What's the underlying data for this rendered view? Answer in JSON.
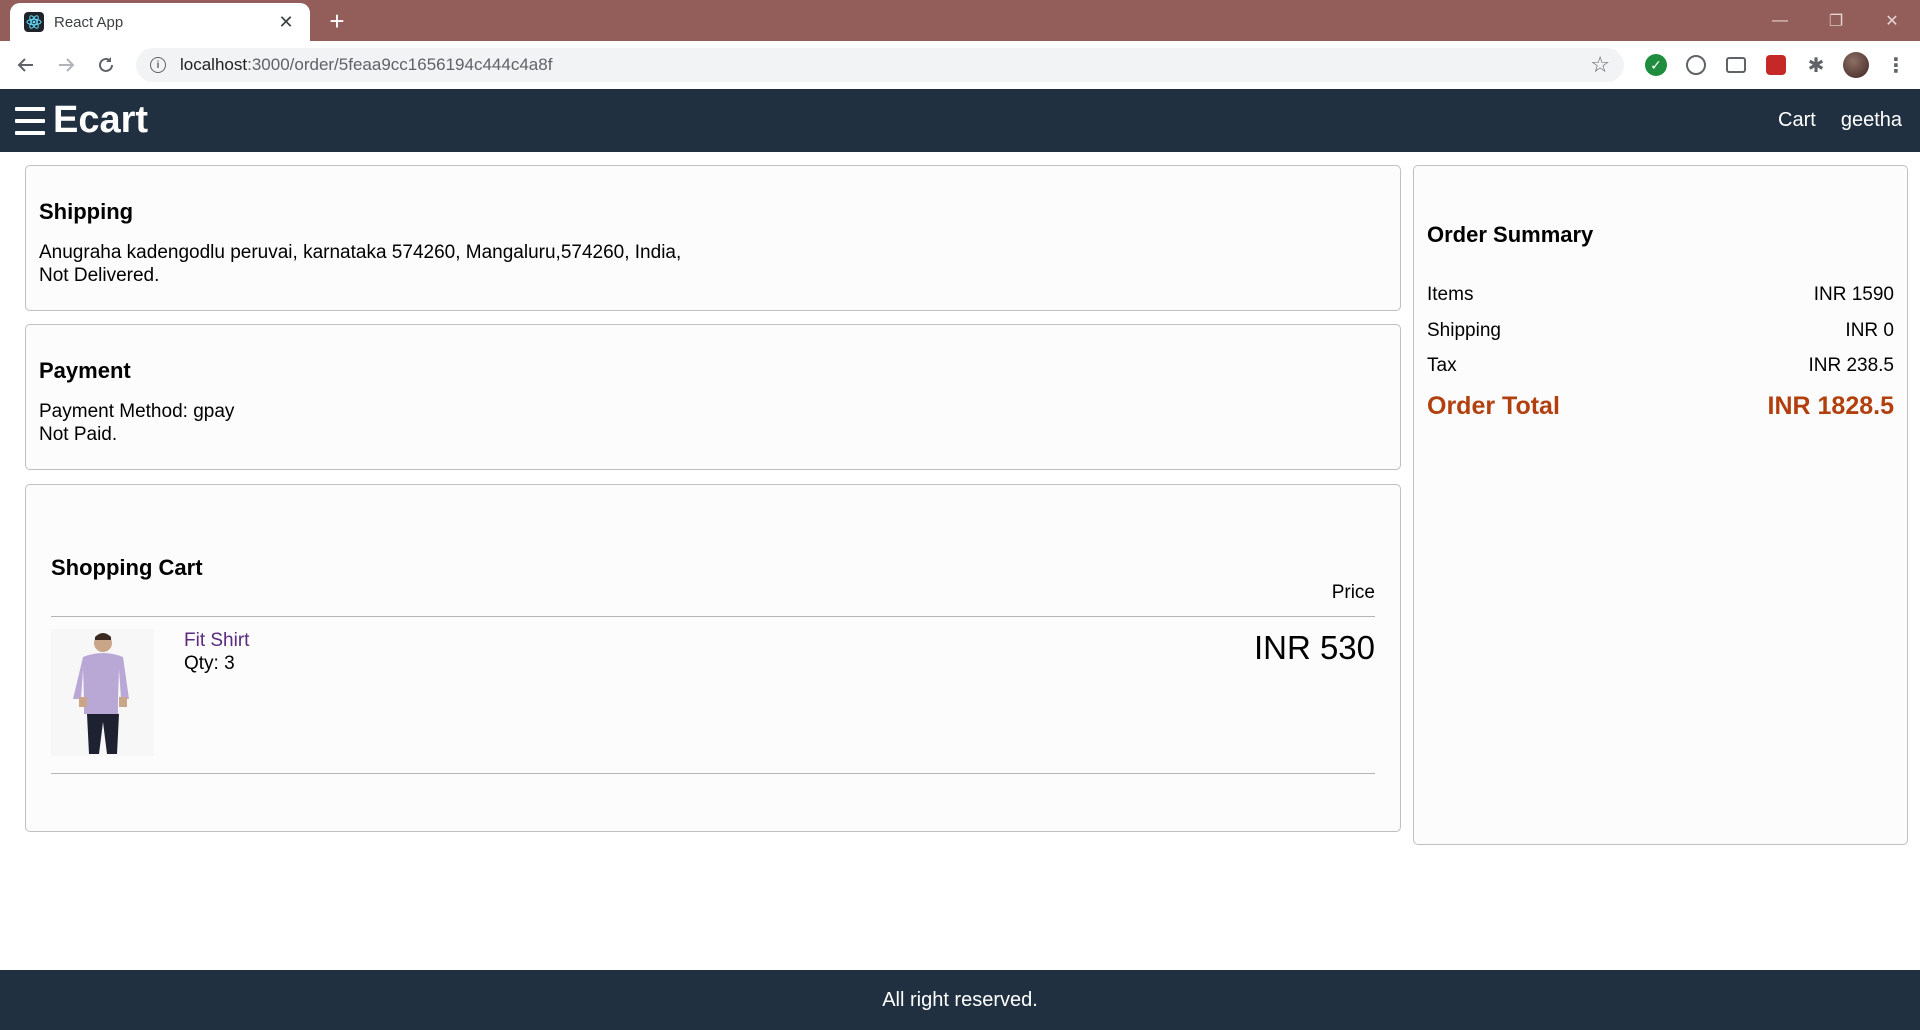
{
  "browser": {
    "tab_title": "React App",
    "url_host": "localhost",
    "url_path": ":3000/order/5feaa9cc1656194c444c4a8f"
  },
  "header": {
    "brand": "Ecart",
    "links": [
      "Cart",
      "geetha"
    ]
  },
  "shipping": {
    "title": "Shipping",
    "address": "Anugraha kadengodlu peruvai, karnataka 574260, Mangaluru,574260, India,",
    "status": "Not Delivered."
  },
  "payment": {
    "title": "Payment",
    "method": "Payment Method: gpay",
    "status": "Not Paid."
  },
  "cart": {
    "title": "Shopping Cart",
    "price_header": "Price",
    "items": [
      {
        "name": "Fit Shirt",
        "qty": "Qty: 3",
        "price": "INR 530"
      }
    ]
  },
  "summary": {
    "title": "Order Summary",
    "rows": [
      {
        "label": "Items",
        "value": "INR 1590"
      },
      {
        "label": "Shipping",
        "value": "INR 0"
      },
      {
        "label": "Tax",
        "value": "INR 238.5"
      }
    ],
    "total_label": "Order Total",
    "total_value": "INR 1828.5",
    "total_color": "#b2400f"
  },
  "footer": {
    "text": "All right reserved."
  },
  "colors": {
    "header_bg": "#203040",
    "tabstrip_bg": "#935e5a",
    "link_purple": "#5b2a80"
  }
}
